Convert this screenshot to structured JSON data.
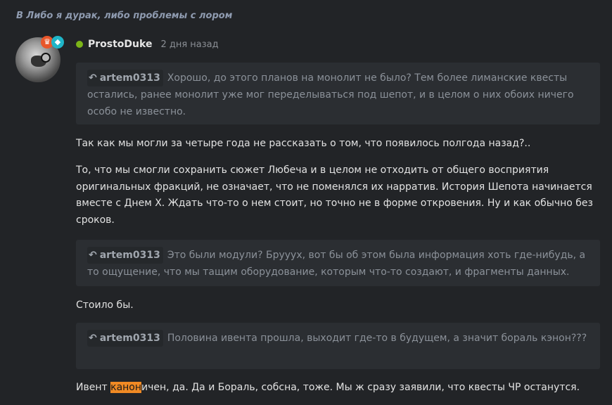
{
  "thread": {
    "title": "В Либо я дурак, либо проблемы с лором"
  },
  "post": {
    "author": "ProstoDuke",
    "time": "2 дня назад",
    "avatar_icon": "hawk-avatar",
    "badges": [
      "trophy-icon",
      "diamond-icon"
    ],
    "online_color": "#7cb518"
  },
  "quotes": [
    {
      "author": "artem0313",
      "text": "Хорошо, до этого планов на монолит не было? Тем более лиманские квесты остались, ранее монолит уже мог переделываться под шепот, и в целом о них обоих ничего особо не известно."
    },
    {
      "author": "artem0313",
      "text": "Это были модули? Брууух, вот бы об этом была информация хоть где-нибудь, а то ощущение, что мы тащим оборудование, которым что-то создают, и фрагменты данных."
    },
    {
      "author": "artem0313",
      "text": "Половина ивента прошла, выходит где-то в будущем, а значит бораль кэнон???"
    }
  ],
  "paragraphs": {
    "p1": "Так как мы могли за четыре года не рассказать о том, что появилось полгода назад?..",
    "p2": "То, что мы смогли сохранить сюжет Любеча и в целом не отходить от общего восприятия оригинальных фракций, не означает, что не поменялся их нарратив. История Шепота начинается вместе с Днем X. Ждать что-то о нем стоит, но точно не в форме откровения. Ну и как обычно без сроков.",
    "p3": "Стоило бы.",
    "p4_prefix": "Ивент ",
    "p4_highlight": "канон",
    "p4_suffix": "ичен, да. Да и Бораль, собсна, тоже. Мы ж сразу заявили, что квесты ЧР останутся."
  },
  "colors": {
    "background": "#222427",
    "quote_bg": "#2b2e32",
    "highlight": "#f08a24",
    "title": "#8f9bb0"
  }
}
